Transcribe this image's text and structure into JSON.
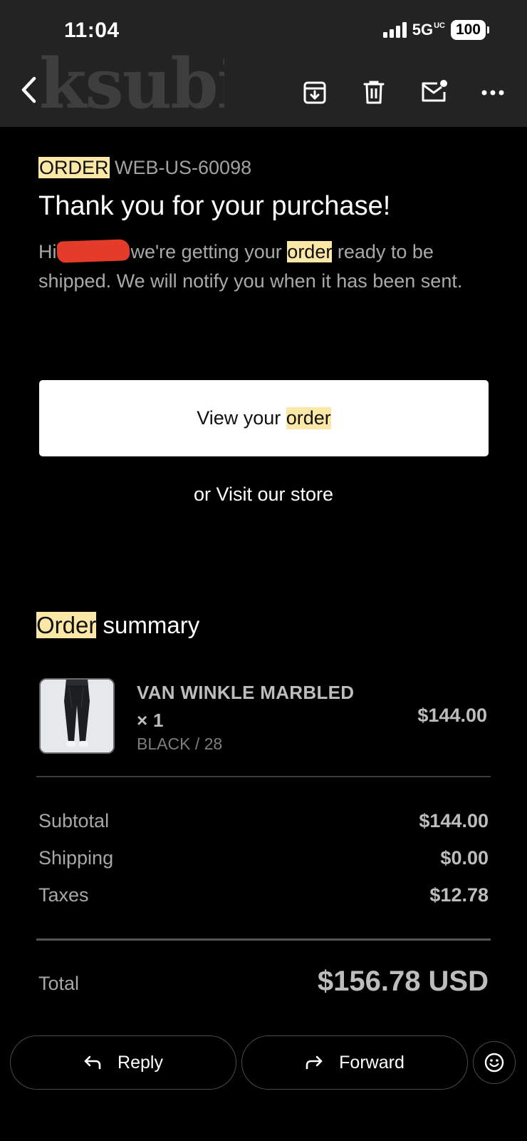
{
  "status_bar": {
    "time": "11:04",
    "network": "5G",
    "network_suffix": "UC",
    "battery": "100"
  },
  "header": {
    "watermark_logo_text": "ksubi",
    "actions": [
      {
        "name": "back",
        "icon": "chevron-left-icon"
      },
      {
        "name": "archive",
        "icon": "archive-icon"
      },
      {
        "name": "delete",
        "icon": "trash-icon"
      },
      {
        "name": "mark-unread",
        "icon": "mail-unread-icon"
      },
      {
        "name": "more",
        "icon": "more-horizontal-icon"
      }
    ]
  },
  "email": {
    "order_keyword": "ORDER",
    "order_number": "WEB-US-60098",
    "headline": "Thank you for your purchase!",
    "greeting": "Hi",
    "intro_before": "we're getting your",
    "intro_keyword": "order",
    "intro_after": "ready to be shipped. We will notify you when it has been sent.",
    "view_button_prefix": "View your",
    "view_button_keyword": "order",
    "visit_link": "or Visit our store",
    "highlight_color": "#fbe7a6"
  },
  "summary": {
    "title_keyword": "Order",
    "title_rest": "summary",
    "item": {
      "name": "VAN WINKLE MARBLED × 1",
      "variant": "BLACK / 28",
      "price": "$144.00"
    },
    "subtotal_label": "Subtotal",
    "subtotal_value": "$144.00",
    "shipping_label": "Shipping",
    "shipping_value": "$0.00",
    "taxes_label": "Taxes",
    "taxes_value": "$12.78",
    "total_label": "Total",
    "total_value": "$156.78 USD"
  },
  "footer": {
    "reply_label": "Reply",
    "forward_label": "Forward",
    "emoji_icon": "smiley-icon"
  }
}
